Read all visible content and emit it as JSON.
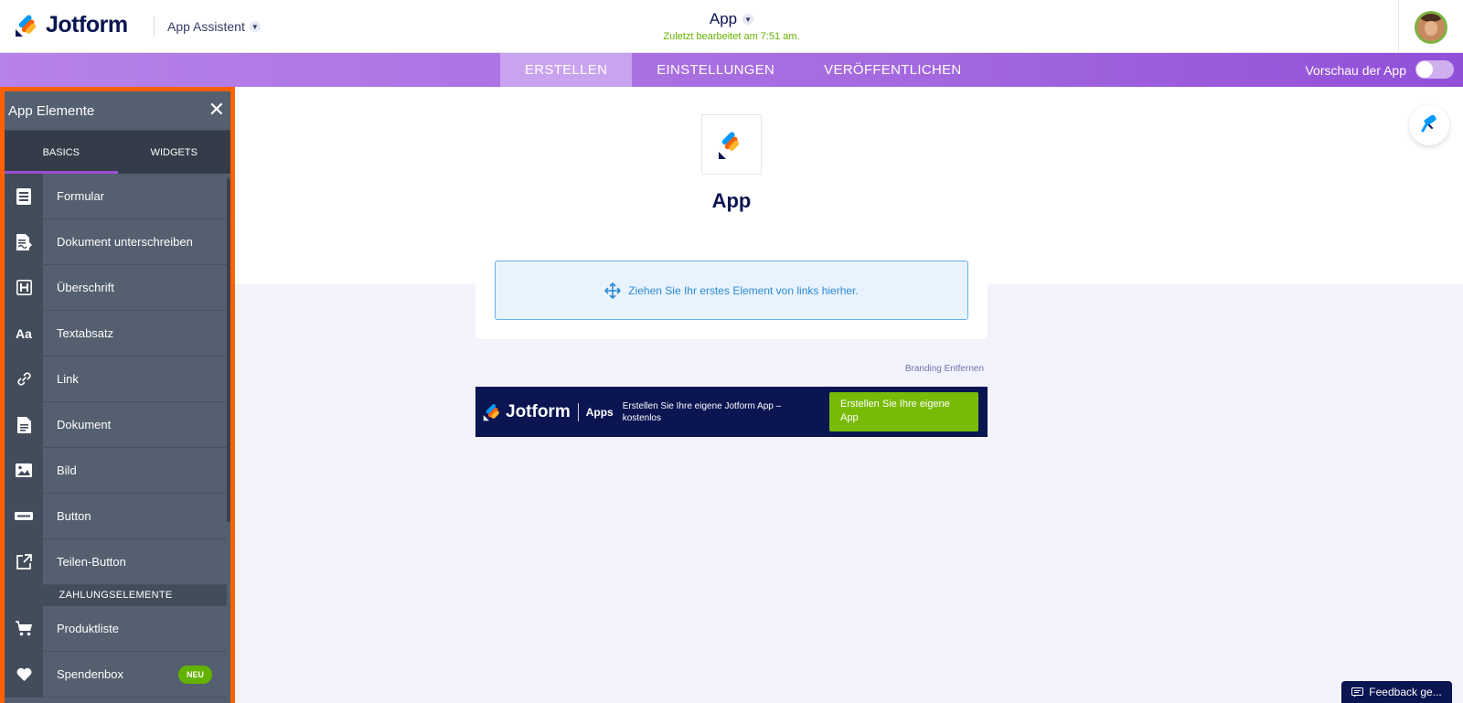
{
  "header": {
    "brand": "Jotform",
    "assistant_label": "App Assistent",
    "app_title": "App",
    "last_edited": "Zuletzt bearbeitet am 7:51 am."
  },
  "tabs": [
    {
      "label": "ERSTELLEN",
      "active": true
    },
    {
      "label": "EINSTELLUNGEN",
      "active": false
    },
    {
      "label": "VERÖFFENTLICHEN",
      "active": false
    }
  ],
  "preview_label": "Vorschau der App",
  "preview_enabled": false,
  "panel": {
    "title": "App Elemente",
    "tabs": [
      {
        "label": "BASICS",
        "active": true
      },
      {
        "label": "WIDGETS",
        "active": false
      }
    ],
    "items": [
      {
        "label": "Formular",
        "icon": "form-icon"
      },
      {
        "label": "Dokument unterschreiben",
        "icon": "sign-document-icon"
      },
      {
        "label": "Überschrift",
        "icon": "heading-icon"
      },
      {
        "label": "Textabsatz",
        "icon": "paragraph-icon"
      },
      {
        "label": "Link",
        "icon": "link-icon"
      },
      {
        "label": "Dokument",
        "icon": "document-icon"
      },
      {
        "label": "Bild",
        "icon": "image-icon"
      },
      {
        "label": "Button",
        "icon": "button-icon"
      },
      {
        "label": "Teilen-Button",
        "icon": "share-icon"
      }
    ],
    "section_label": "ZAHLUNGSELEMENTE",
    "payment_items": [
      {
        "label": "Produktliste",
        "icon": "cart-icon"
      },
      {
        "label": "Spendenbox",
        "icon": "heart-icon",
        "badge": "NEU"
      }
    ]
  },
  "canvas": {
    "app_name": "App",
    "drop_hint": "Ziehen Sie Ihr erstes Element von links hierher.",
    "branding_remove": "Branding Entfernen",
    "banner": {
      "brand": "Jotform",
      "apps": "Apps",
      "text": "Erstellen Sie Ihre eigene Jotform App – kostenlos",
      "button": "Erstellen Sie Ihre eigene App"
    }
  },
  "feedback_label": "Feedback ge...",
  "colors": {
    "brand_navy": "#0a1551",
    "tab_purple": "#a56ae0",
    "panel_bg": "#545f6f",
    "highlight_border": "#ff6100",
    "success_green": "#64b200",
    "dropzone_blue": "#2e8ad4"
  }
}
